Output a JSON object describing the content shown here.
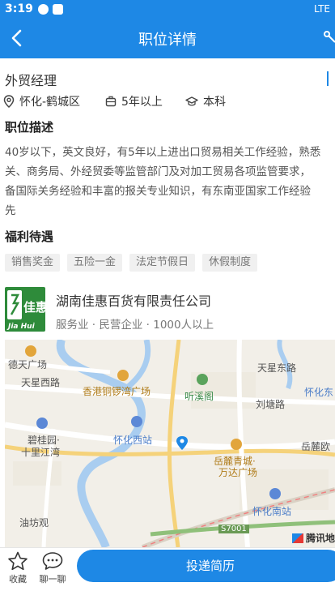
{
  "status": {
    "time": "3:19",
    "network": "LTE"
  },
  "nav": {
    "title": "职位详情"
  },
  "job": {
    "title": "外贸经理",
    "location": "怀化-鹤城区",
    "experience": "5年以上",
    "education": "本科"
  },
  "sections": {
    "description": "职位描述",
    "benefits": "福利待遇"
  },
  "description_lines": [
    "40岁以下，英文良好，有5年以上进出口贸易相关工作经验，熟悉",
    "关、商务局、外经贸委等监管部门及对加工贸易各项监管要求，",
    "备国际关务经验和丰富的报关专业知识，有东南亚国家工作经验",
    "先"
  ],
  "benefits": [
    "销售奖金",
    "五险一金",
    "法定节假日",
    "休假制度"
  ],
  "company": {
    "name": "湖南佳惠百货有限责任公司",
    "info": "服务业 · 民营企业 · 1000人以上",
    "logo_text": "佳惠",
    "logo_sub": "Jia Hui"
  },
  "map": {
    "labels": {
      "detian": "德天广场",
      "tianxing_west": "天星西路",
      "hk_plaza": "香港铜锣湾广场",
      "tingxi": "听溪阁",
      "tianxing_east": "天星东路",
      "huaihua_east": "怀化东",
      "liutang": "刘塘路",
      "biguiyuan": "碧桂园·",
      "shilijiang": "十里江湾",
      "huaihua_west": "怀化西站",
      "yuelu": "岳麓欧",
      "yueli": "岳麓青城·",
      "wanda": "万达广场",
      "huaihua_south": "怀化南站",
      "youfang": "油坊观",
      "road": "S7001",
      "brand": "腾讯地"
    }
  },
  "bottom": {
    "favorite": "收藏",
    "chat": "聊一聊",
    "apply": "投递简历"
  },
  "colors": {
    "primary": "#1e88e5",
    "logo_green": "#2e8b3a"
  }
}
